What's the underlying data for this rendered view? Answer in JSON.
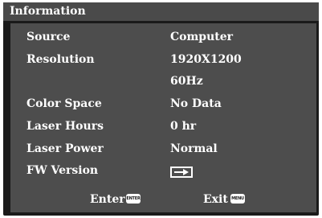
{
  "title": "Information",
  "rows": [
    {
      "label": "Source",
      "value": "Computer"
    },
    {
      "label": "Resolution",
      "value": "1920X1200"
    },
    {
      "label": "",
      "value": "60Hz"
    },
    {
      "label": "Color Space",
      "value": "No Data"
    },
    {
      "label": "Laser Hours",
      "value": "0 hr"
    },
    {
      "label": "Laser Power",
      "value": "Normal"
    },
    {
      "label": "FW Version",
      "icon": "firmware-arrow-icon"
    }
  ],
  "footer": {
    "enter_label": "Enter",
    "enter_key": "ENTER",
    "exit_label": "Exit",
    "exit_key": "MENU"
  },
  "colors": {
    "frame": "#1a1a1a",
    "title_bar": "#4a4a4a",
    "panel": "#4d4d4d",
    "text": "#ffffff"
  }
}
